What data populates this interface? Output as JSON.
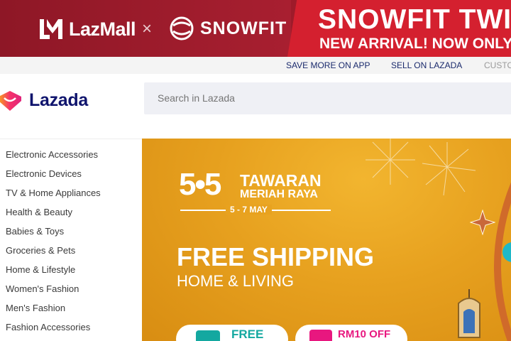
{
  "promo": {
    "lazmall_text": "LazMall",
    "times": "×",
    "snowfit_text": "SNOWFIT",
    "headline": "SNOWFIT TWIN",
    "subline": "NEW ARRIVAL! NOW ONLY R"
  },
  "utility_bar": {
    "save_more": "SAVE MORE ON APP",
    "sell": "SELL ON LAZADA",
    "customer": "CUSTO"
  },
  "header": {
    "logo_text": "Lazada",
    "search_placeholder": "Search in Lazada"
  },
  "sidebar": {
    "items": [
      "Electronic Accessories",
      "Electronic Devices",
      "TV & Home Appliances",
      "Health & Beauty",
      "Babies & Toys",
      "Groceries & Pets",
      "Home & Lifestyle",
      "Women's Fashion",
      "Men's Fashion",
      "Fashion Accessories"
    ]
  },
  "hero": {
    "big_55": "5•5",
    "tawaran": "TAWARAN",
    "meriah": "MERIAH RAYA",
    "date": "5 - 7 MAY",
    "free_shipping": "FREE SHIPPING",
    "home_living": "HOME & LIVING",
    "pill_free": "FREE",
    "pill_rm10": "RM10 OFF"
  },
  "colors": {
    "promo_bg": "#9e1b2a",
    "lazada_navy": "#0f146d",
    "hero_orange": "#e7a11f"
  }
}
